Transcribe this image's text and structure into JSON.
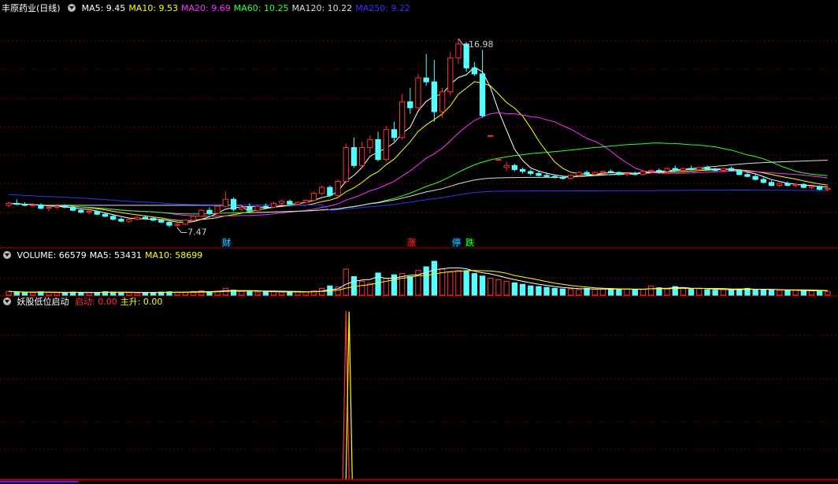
{
  "main_header": {
    "stock_title": "丰原药业(日线)",
    "ma": [
      {
        "label": "MA5:",
        "value": "9.45",
        "color": "#ffffff"
      },
      {
        "label": "MA10:",
        "value": "9.53",
        "color": "#ffff00"
      },
      {
        "label": "MA20:",
        "value": "9.69",
        "color": "#ff33ff"
      },
      {
        "label": "MA60:",
        "value": "10.25",
        "color": "#33ff33"
      },
      {
        "label": "MA120:",
        "value": "10.22",
        "color": "#dddddd"
      },
      {
        "label": "MA250:",
        "value": "9.22",
        "color": "#3333ff"
      }
    ]
  },
  "annotations": {
    "high": "16.98",
    "low": "7.47"
  },
  "markers": [
    {
      "text": "财",
      "color": "#33ccff",
      "bg": "#001a33"
    },
    {
      "text": "涨",
      "color": "#ff3333",
      "bg": "#330000"
    },
    {
      "text": "停",
      "color": "#33ccff",
      "bg": "#001a33"
    },
    {
      "text": "跌",
      "color": "#33ff33",
      "bg": "#002200"
    }
  ],
  "volume_header": {
    "items": [
      {
        "label": "VOLUME:",
        "value": "66579",
        "color": "#ffffff"
      },
      {
        "label": "MA5:",
        "value": "53431",
        "color": "#ffffff"
      },
      {
        "label": "MA10:",
        "value": "58699",
        "color": "#ffff00"
      }
    ]
  },
  "indicator_header": {
    "name": "妖股低位启动",
    "items": [
      {
        "label": "启动:",
        "value": "0.00",
        "color": "#ff3333"
      },
      {
        "label": "主升:",
        "value": "0.00",
        "color": "#ffff00"
      }
    ]
  },
  "colors": {
    "up": "#ff3333",
    "down": "#54ffff",
    "grid": "#660000",
    "panel_border": "#aa0000"
  },
  "chart_data": {
    "type": "candlestick",
    "price_range": [
      6.5,
      18.2
    ],
    "candles": [
      [
        8.6,
        8.8,
        8.5,
        8.7
      ],
      [
        8.7,
        8.9,
        8.6,
        8.65
      ],
      [
        8.65,
        8.75,
        8.55,
        8.6
      ],
      [
        8.6,
        8.7,
        8.5,
        8.62
      ],
      [
        8.62,
        8.7,
        8.4,
        8.45
      ],
      [
        8.45,
        8.55,
        8.3,
        8.5
      ],
      [
        8.5,
        8.6,
        8.4,
        8.55
      ],
      [
        8.55,
        8.65,
        8.45,
        8.5
      ],
      [
        8.5,
        8.55,
        8.3,
        8.35
      ],
      [
        8.35,
        8.45,
        8.2,
        8.25
      ],
      [
        8.25,
        8.4,
        8.15,
        8.3
      ],
      [
        8.3,
        8.35,
        8.1,
        8.15
      ],
      [
        8.15,
        8.2,
        8.0,
        8.05
      ],
      [
        8.05,
        8.1,
        7.85,
        7.9
      ],
      [
        7.9,
        8.0,
        7.75,
        7.8
      ],
      [
        7.8,
        7.95,
        7.7,
        7.9
      ],
      [
        7.9,
        8.05,
        7.85,
        8.0
      ],
      [
        8.0,
        8.1,
        7.9,
        7.95
      ],
      [
        7.95,
        8.0,
        7.8,
        7.85
      ],
      [
        7.85,
        7.9,
        7.7,
        7.75
      ],
      [
        7.75,
        7.85,
        7.5,
        7.6
      ],
      [
        7.6,
        7.7,
        7.47,
        7.65
      ],
      [
        7.65,
        7.9,
        7.6,
        7.85
      ],
      [
        7.85,
        8.1,
        7.8,
        8.05
      ],
      [
        8.05,
        8.4,
        8.0,
        8.35
      ],
      [
        8.35,
        8.5,
        8.1,
        8.2
      ],
      [
        8.2,
        8.6,
        8.15,
        8.55
      ],
      [
        8.55,
        9.3,
        8.5,
        8.9
      ],
      [
        8.9,
        9.0,
        8.3,
        8.4
      ],
      [
        8.4,
        8.6,
        8.3,
        8.5
      ],
      [
        8.5,
        8.7,
        8.3,
        8.35
      ],
      [
        8.35,
        8.6,
        8.3,
        8.55
      ],
      [
        8.55,
        8.7,
        8.4,
        8.5
      ],
      [
        8.5,
        8.8,
        8.45,
        8.7
      ],
      [
        8.7,
        8.9,
        8.6,
        8.8
      ],
      [
        8.8,
        8.9,
        8.6,
        8.65
      ],
      [
        8.65,
        8.8,
        8.6,
        8.75
      ],
      [
        8.75,
        8.9,
        8.7,
        8.85
      ],
      [
        8.85,
        9.3,
        8.8,
        9.2
      ],
      [
        9.2,
        9.6,
        9.1,
        9.5
      ],
      [
        9.5,
        9.6,
        9.0,
        9.1
      ],
      [
        9.1,
        9.9,
        9.0,
        9.8
      ],
      [
        9.8,
        11.7,
        9.7,
        11.5
      ],
      [
        11.5,
        12.0,
        10.5,
        10.6
      ],
      [
        10.6,
        11.8,
        10.5,
        11.5
      ],
      [
        11.5,
        12.1,
        11.2,
        11.9
      ],
      [
        11.9,
        12.3,
        10.8,
        10.9
      ],
      [
        10.9,
        12.6,
        10.8,
        12.4
      ],
      [
        12.4,
        12.8,
        11.8,
        12.0
      ],
      [
        12.0,
        14.2,
        11.9,
        13.8
      ],
      [
        13.8,
        14.5,
        13.2,
        13.5
      ],
      [
        13.5,
        15.2,
        13.4,
        15.0
      ],
      [
        15.0,
        16.2,
        14.6,
        14.8
      ],
      [
        14.8,
        15.9,
        12.8,
        13.3
      ],
      [
        13.3,
        14.5,
        13.0,
        14.3
      ],
      [
        14.3,
        16.3,
        14.1,
        16.0
      ],
      [
        16.0,
        16.98,
        15.7,
        16.7
      ],
      [
        16.7,
        16.8,
        15.3,
        15.5
      ],
      [
        15.5,
        15.8,
        15.1,
        15.2
      ],
      [
        15.2,
        16.4,
        13.0,
        13.1
      ],
      [
        12.1,
        12.1,
        12.05,
        12.1
      ],
      [
        10.9,
        10.9,
        10.85,
        10.9
      ],
      [
        10.5,
        10.8,
        10.3,
        10.6
      ],
      [
        10.6,
        10.7,
        10.3,
        10.4
      ],
      [
        10.4,
        10.5,
        10.2,
        10.3
      ],
      [
        10.3,
        10.4,
        10.1,
        10.2
      ],
      [
        10.2,
        10.3,
        10.05,
        10.1
      ],
      [
        10.1,
        10.2,
        10.0,
        10.05
      ],
      [
        10.05,
        10.15,
        9.95,
        10.0
      ],
      [
        10.0,
        10.1,
        9.9,
        9.95
      ],
      [
        9.95,
        10.15,
        9.9,
        10.1
      ],
      [
        10.1,
        10.3,
        10.0,
        10.25
      ],
      [
        10.25,
        10.35,
        10.1,
        10.15
      ],
      [
        10.15,
        10.3,
        10.1,
        10.25
      ],
      [
        10.25,
        10.35,
        10.15,
        10.3
      ],
      [
        10.3,
        10.4,
        10.2,
        10.25
      ],
      [
        10.25,
        10.3,
        10.1,
        10.15
      ],
      [
        10.15,
        10.25,
        10.05,
        10.2
      ],
      [
        10.2,
        10.3,
        10.1,
        10.15
      ],
      [
        10.15,
        10.35,
        10.1,
        10.3
      ],
      [
        10.3,
        10.4,
        10.2,
        10.35
      ],
      [
        10.35,
        10.45,
        10.2,
        10.3
      ],
      [
        10.3,
        10.5,
        10.25,
        10.45
      ],
      [
        10.45,
        10.6,
        10.3,
        10.35
      ],
      [
        10.35,
        10.5,
        10.3,
        10.45
      ],
      [
        10.45,
        10.6,
        10.35,
        10.4
      ],
      [
        10.4,
        10.55,
        10.3,
        10.5
      ],
      [
        10.5,
        10.6,
        10.35,
        10.4
      ],
      [
        10.4,
        10.5,
        10.3,
        10.35
      ],
      [
        10.35,
        10.5,
        10.25,
        10.45
      ],
      [
        10.45,
        10.55,
        10.3,
        10.35
      ],
      [
        10.35,
        10.4,
        10.1,
        10.15
      ],
      [
        10.15,
        10.25,
        10.0,
        10.05
      ],
      [
        10.05,
        10.15,
        9.85,
        9.9
      ],
      [
        9.9,
        10.0,
        9.7,
        9.75
      ],
      [
        9.75,
        9.85,
        9.55,
        9.6
      ],
      [
        9.6,
        9.75,
        9.5,
        9.7
      ],
      [
        9.7,
        9.8,
        9.55,
        9.6
      ],
      [
        9.6,
        9.7,
        9.5,
        9.65
      ],
      [
        9.65,
        9.7,
        9.45,
        9.5
      ],
      [
        9.5,
        9.6,
        9.4,
        9.55
      ],
      [
        9.55,
        9.6,
        9.35,
        9.4
      ],
      [
        9.4,
        9.5,
        9.3,
        9.45
      ]
    ],
    "ma_series": [
      {
        "key": "ma5",
        "color": "#ffffff",
        "period": 5
      },
      {
        "key": "ma10",
        "color": "#ffff00",
        "period": 10
      },
      {
        "key": "ma20",
        "color": "#ff33ff",
        "period": 20
      },
      {
        "key": "ma60",
        "color": "#33ff33",
        "period": 40
      },
      {
        "key": "ma120",
        "color": "#dddddd",
        "period": 70
      },
      {
        "key": "ma250",
        "color": "#3333ff",
        "period": 110
      }
    ],
    "volumes": [
      12,
      10,
      9,
      8,
      11,
      9,
      8,
      7,
      10,
      9,
      8,
      9,
      11,
      10,
      9,
      8,
      7,
      9,
      8,
      10,
      11,
      9,
      10,
      12,
      14,
      11,
      13,
      22,
      16,
      12,
      11,
      10,
      12,
      11,
      10,
      9,
      11,
      10,
      14,
      22,
      30,
      26,
      85,
      60,
      45,
      38,
      72,
      55,
      66,
      70,
      60,
      80,
      92,
      110,
      85,
      75,
      80,
      78,
      70,
      62,
      55,
      50,
      45,
      40,
      35,
      30,
      28,
      25,
      22,
      20,
      20,
      18,
      22,
      19,
      20,
      21,
      18,
      20,
      17,
      19,
      30,
      24,
      20,
      28,
      22,
      19,
      21,
      18,
      16,
      18,
      17,
      20,
      22,
      19,
      18,
      16,
      15,
      14,
      16,
      15,
      14,
      13,
      12
    ],
    "indicator": {
      "labels": [
        "启动",
        "主升"
      ],
      "spike_index": 42,
      "spike_value": 1.0,
      "current": [
        0.0,
        0.0
      ]
    }
  }
}
